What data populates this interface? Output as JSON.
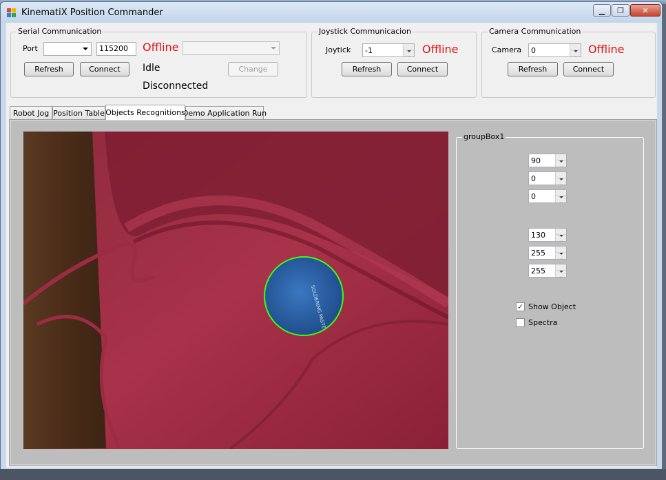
{
  "window": {
    "title": "KinematiX Position Commander"
  },
  "colors": {
    "offline": "#e01010",
    "detection_circle": "#39ff14"
  },
  "serial": {
    "title": "Serial Communication",
    "port_label": "Port",
    "port_value": "",
    "baud_value": "115200",
    "status": "Offline",
    "idle_text": "Idle",
    "connection_text": "Disconnected",
    "refresh_label": "Refresh",
    "connect_label": "Connect",
    "change_label": "Change"
  },
  "joystick": {
    "title": "Joystick Communicacion",
    "label": "Joytick",
    "value": "-1",
    "status": "Offline",
    "refresh_label": "Refresh",
    "connect_label": "Connect"
  },
  "camera": {
    "title": "Camera Communication",
    "label": "Camera",
    "value": "0",
    "status": "Offline",
    "refresh_label": "Refresh",
    "connect_label": "Connect"
  },
  "tabs": [
    {
      "label": "Robot Jog"
    },
    {
      "label": "Position Table"
    },
    {
      "label": "Objects Recognitions"
    },
    {
      "label": "Demo Application Run"
    }
  ],
  "groupbox1": {
    "title": "groupBox1",
    "spinners_a": [
      "90",
      "0",
      "0"
    ],
    "spinners_b": [
      "130",
      "255",
      "255"
    ],
    "show_object_label": "Show Object",
    "show_object_checked": true,
    "spectra_label": "Spectra",
    "spectra_checked": false
  }
}
